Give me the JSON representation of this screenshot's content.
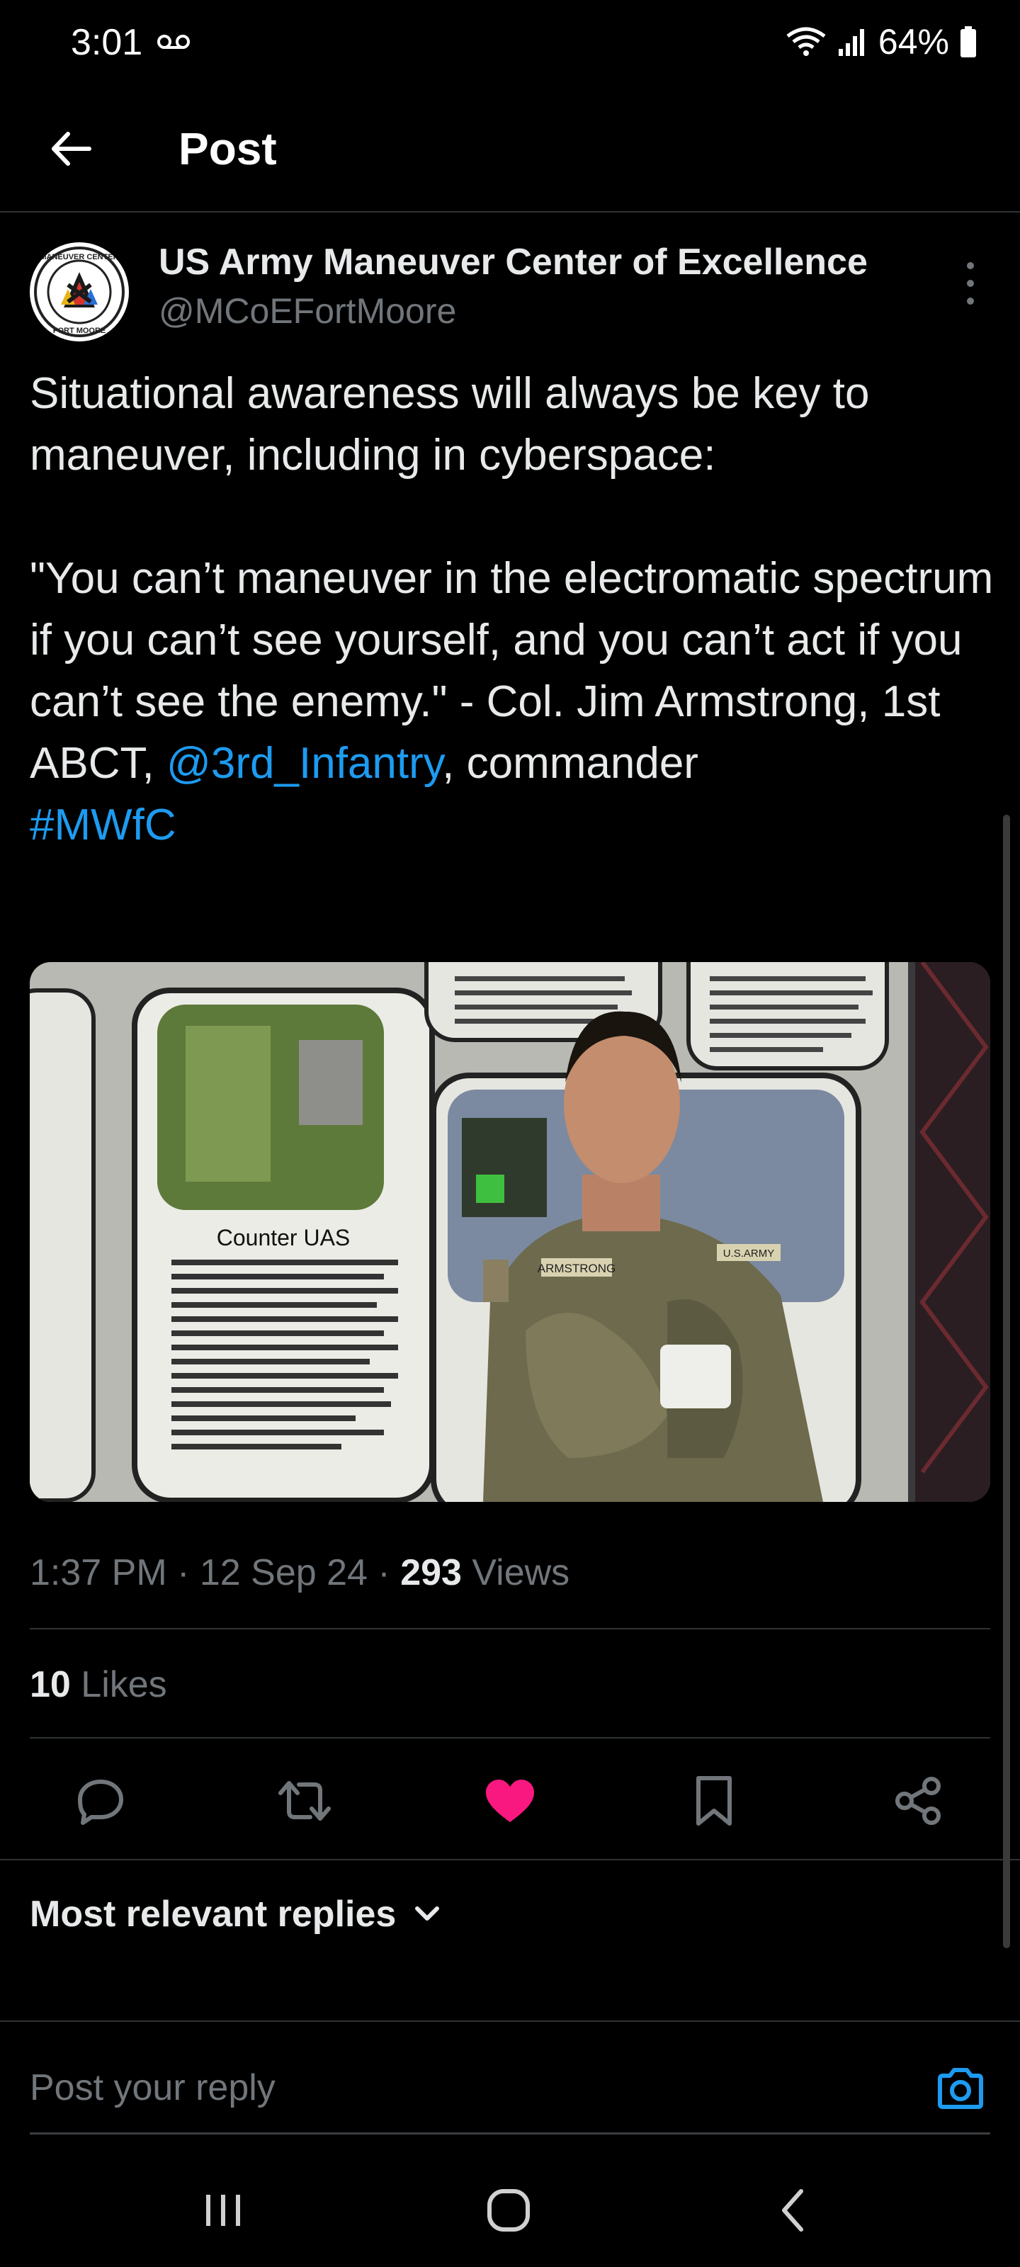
{
  "status_bar": {
    "time": "3:01",
    "battery": "64%"
  },
  "header": {
    "title": "Post"
  },
  "author": {
    "name": "US Army Maneuver Center of Excellence",
    "handle": "@MCoEFortMoore"
  },
  "tweet": {
    "line1": "Situational awareness will always be key to maneuver, including in cyberspace:",
    "line2": "\"You can’t maneuver in the electromatic spectrum if you can’t see yourself, and you can’t act if you can’t see the enemy.\" - Col. Jim Armstrong, 1st ABCT,",
    "mention": "@3rd_Infantry",
    "line3": ", commander",
    "hashtag": "#MWfC"
  },
  "media": {
    "slide_heading": "Counter UAS",
    "name_tape": "ARMSTRONG",
    "branch_tape": "U.S.ARMY"
  },
  "meta": {
    "time": "1:37 PM",
    "separator": " · ",
    "date": "12 Sep 24",
    "views_count": "293",
    "views_label": " Views"
  },
  "likes": {
    "count": "10",
    "label": " Likes"
  },
  "colors": {
    "accent": "#1d9bf0",
    "like": "#f91880",
    "muted": "#71767b"
  },
  "replies": {
    "sort_label": "Most relevant replies"
  },
  "composer": {
    "placeholder": "Post your reply"
  }
}
